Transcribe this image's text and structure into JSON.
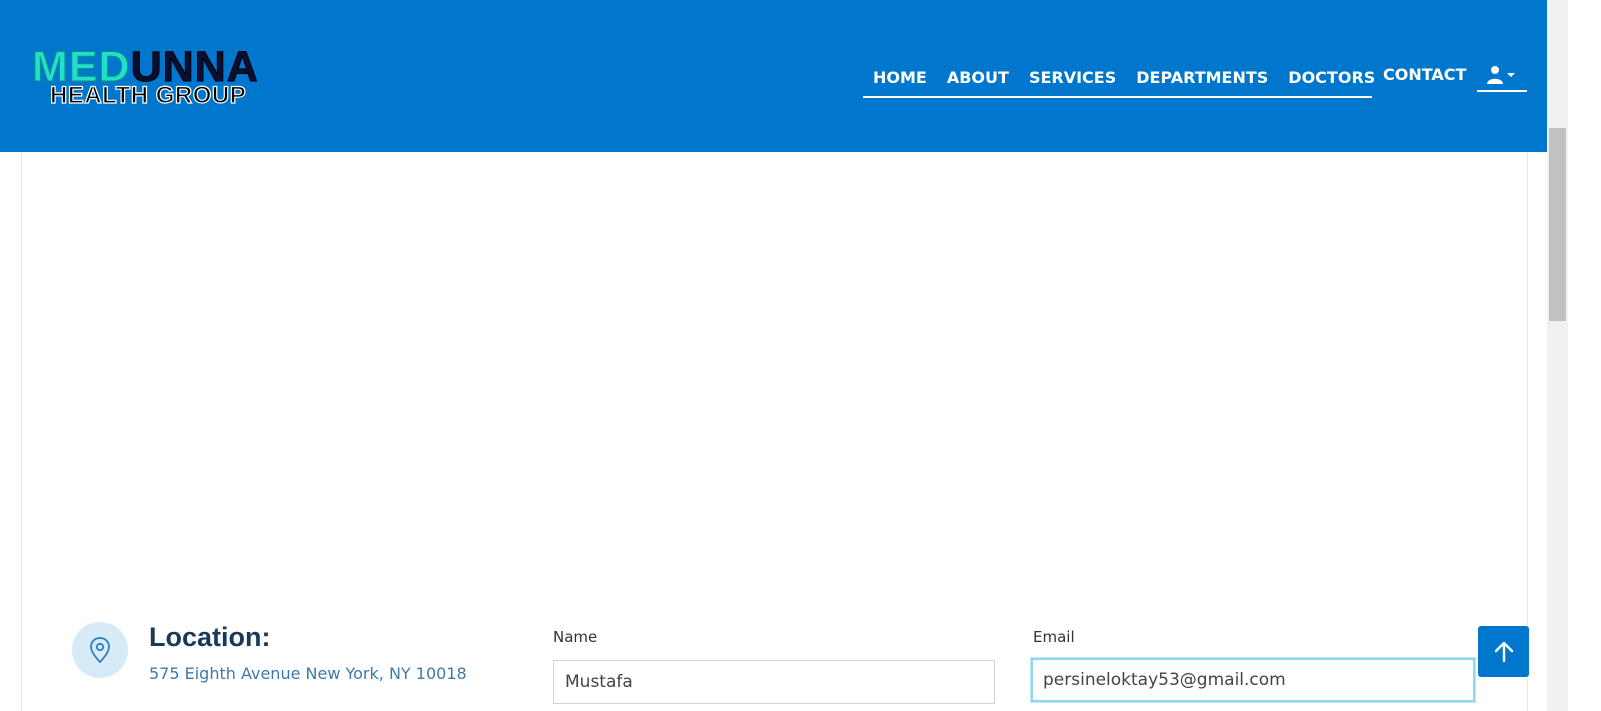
{
  "brand": {
    "logo_line1_a": "MED",
    "logo_line1_b": "UNNA",
    "logo_line2": "HEALTH GROUP",
    "primary_color": "#0077cc"
  },
  "nav": {
    "items": [
      {
        "label": "HOME"
      },
      {
        "label": "ABOUT"
      },
      {
        "label": "SERVICES"
      },
      {
        "label": "DEPARTMENTS"
      },
      {
        "label": "DOCTORS"
      }
    ],
    "contact_label": "CONTACT",
    "user_icon": "user-icon"
  },
  "location": {
    "icon": "map-pin-icon",
    "title": "Location:",
    "address": "575 Eighth Avenue New York, NY 10018"
  },
  "form": {
    "name_label": "Name",
    "name_value": "Mustafa",
    "email_label": "Email",
    "email_value": "persineloktay53@gmail.com"
  },
  "back_to_top": {
    "icon": "arrow-up-icon"
  }
}
